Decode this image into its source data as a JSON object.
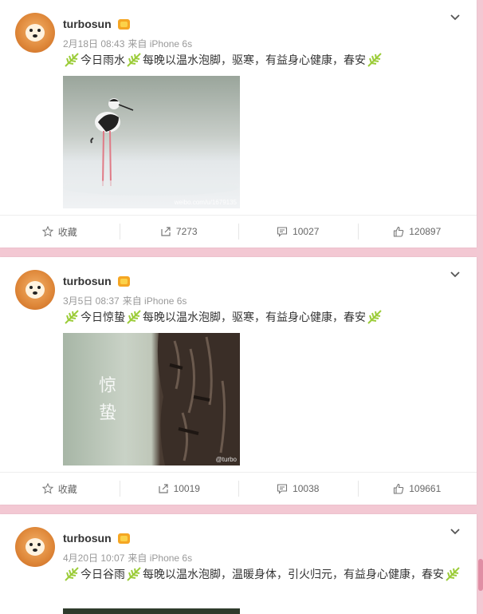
{
  "posts": [
    {
      "username": "turbosun",
      "date": "2月18日 08:43",
      "source": "来自 iPhone 6s",
      "text_a": "今日雨水",
      "text_b": "每晚以温水泡脚，驱寒，有益身心健康，春安",
      "watermark": "weibo.com/u/1679135",
      "actions": {
        "favorite": "收藏",
        "repost": "7273",
        "comment": "10027",
        "like": "120897"
      }
    },
    {
      "username": "turbosun",
      "date": "3月5日 08:37",
      "source": "来自 iPhone 6s",
      "text_a": "今日惊蛰",
      "text_b": "每晚以温水泡脚，驱寒，有益身心健康，春安",
      "image_caption": "惊蛰",
      "watermark": "@turbo",
      "actions": {
        "favorite": "收藏",
        "repost": "10019",
        "comment": "10038",
        "like": "109661"
      }
    },
    {
      "username": "turbosun",
      "date": "4月20日 10:07",
      "source": "来自 iPhone 6s",
      "text_a": "今日谷雨",
      "text_b": "每晚以温水泡脚，温暖身体，引火归元，有益身心健康，春安"
    }
  ],
  "icons": {
    "leaf": "green-leaf-emoji",
    "favorite": "star-icon",
    "repost": "repost-arrow-icon",
    "comment": "comment-bubble-icon",
    "like": "thumbs-up-icon",
    "menu": "chevron-down-icon",
    "badge": "vip-badge-icon"
  },
  "colors": {
    "background": "#f3c8d3",
    "leaf": "#9ccc3a",
    "meta": "#999999"
  }
}
